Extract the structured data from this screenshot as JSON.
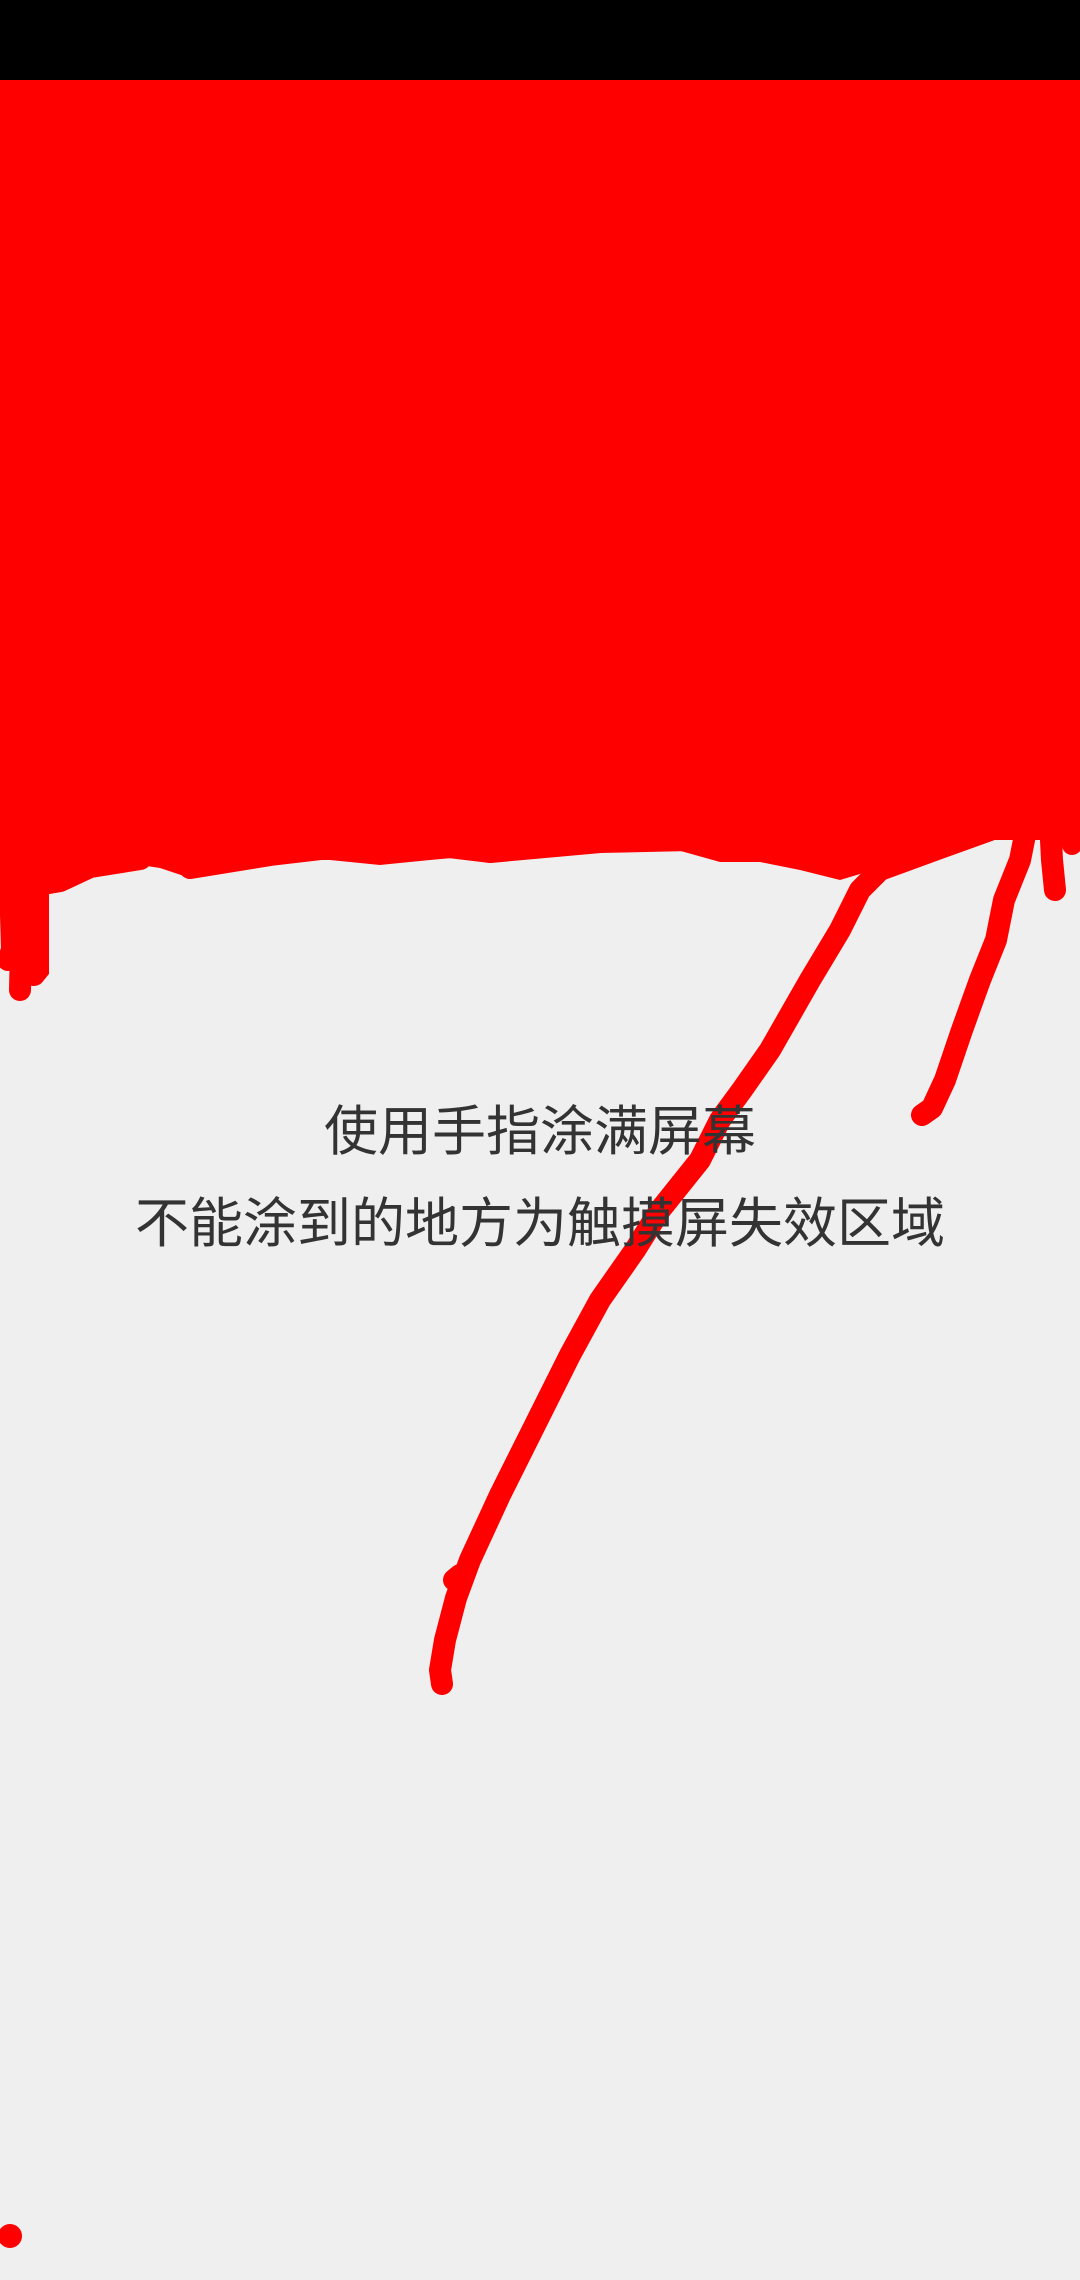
{
  "instructions": {
    "line1": "使用手指涂满屏幕",
    "line2": "不能涂到的地方为触摸屏失效区域"
  },
  "colors": {
    "background": "#efefef",
    "status_bar": "#000000",
    "paint": "#ff0000",
    "text": "#333333"
  }
}
